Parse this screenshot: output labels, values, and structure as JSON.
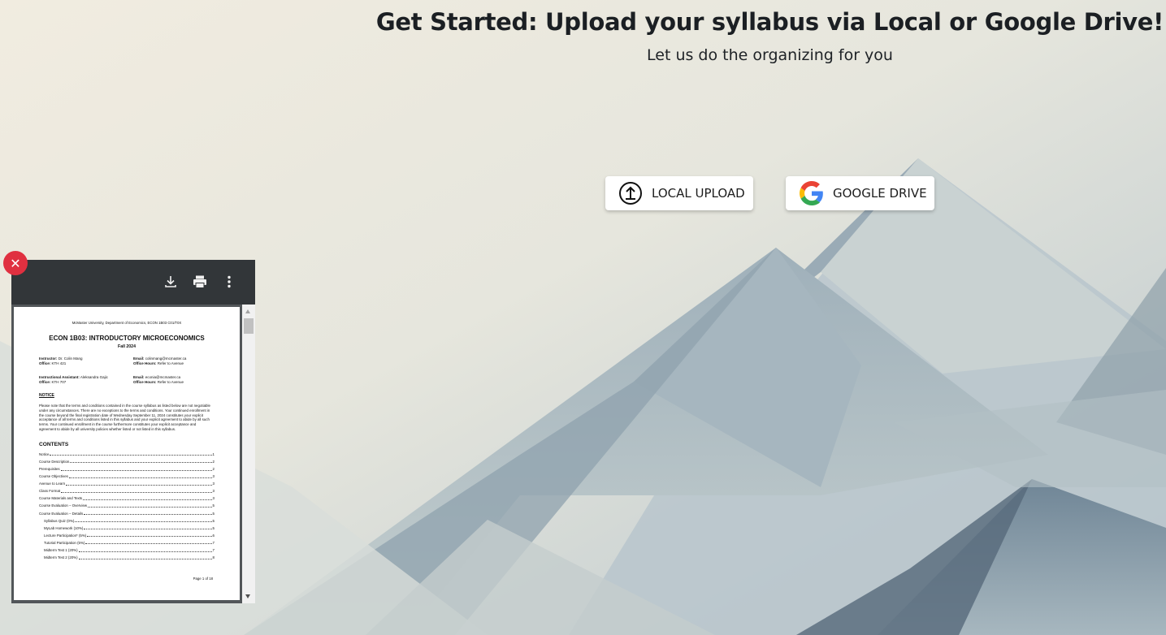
{
  "header": {
    "title": "Get Started: Upload your syllabus via Local or Google Drive!",
    "subtitle": "Let us do the organizing for you"
  },
  "buttons": {
    "local_upload": {
      "label": "LOCAL UPLOAD",
      "icon": "upload-icon"
    },
    "google_drive": {
      "label": "GOOGLE DRIVE",
      "icon": "google-logo-icon"
    }
  },
  "viewer": {
    "close_icon": "close-icon",
    "toolbar_icons": [
      "download-icon",
      "print-icon",
      "more-vert-icon"
    ],
    "page": {
      "header": "McMaster University, Department of Economics, ECON 1B03 C01/T0X",
      "title": "ECON 1B03: INTRODUCTORY MICROECONOMICS",
      "term": "Fall 2024",
      "contacts": [
        {
          "label": "Instructor:",
          "value": "Dr. Colin Mang",
          "label2": "Email:",
          "value2": "colinmang@mcmaster.ca"
        },
        {
          "label": "Office:",
          "value": "KTH 421",
          "label2": "Office Hours:",
          "value2": "Refer to Avenue"
        },
        {
          "label": "Instructional Assistant:",
          "value": "Aleksandra Gajic",
          "label2": "Email:",
          "value2": "econia@mcmaster.ca"
        },
        {
          "label": "Office:",
          "value": "KTH 707",
          "label2": "Office Hours:",
          "value2": "Refer to Avenue"
        }
      ],
      "notice_heading": "NOTICE",
      "notice_text": "Please note that the terms and conditions contained in the course syllabus as listed below are not negotiable under any circumstances. There are no exceptions to the terms and conditions. Your continued enrollment in the course beyond the final registration date of Wednesday September 11, 2024 constitutes your explicit acceptance of all terms and conditions listed in this syllabus and your explicit agreement to abide by all such terms. Your continued enrollment in the course furthermore constitutes your explicit acceptance and agreement to abide by all university policies whether listed or not listed in this syllabus.",
      "contents_heading": "CONTENTS",
      "toc": [
        {
          "title": "Notice",
          "page": "1",
          "sub": false
        },
        {
          "title": "Course Description",
          "page": "2",
          "sub": false
        },
        {
          "title": "Prerequisites",
          "page": "2",
          "sub": false
        },
        {
          "title": "Course Objectives",
          "page": "3",
          "sub": false
        },
        {
          "title": "Avenue to Learn",
          "page": "3",
          "sub": false
        },
        {
          "title": "Class Format",
          "page": "3",
          "sub": false
        },
        {
          "title": "Course Materials and Texts",
          "page": "3",
          "sub": false
        },
        {
          "title": "Course Evaluation – Overview",
          "page": "5",
          "sub": false
        },
        {
          "title": "Course Evaluation – Details",
          "page": "5",
          "sub": false
        },
        {
          "title": "Syllabus Quiz (0%)",
          "page": "5",
          "sub": true
        },
        {
          "title": "MyLab Homework (10%)",
          "page": "5",
          "sub": true
        },
        {
          "title": "Lecture Participation* (5%)",
          "page": "6",
          "sub": true
        },
        {
          "title": "Tutorial Participation (5%)",
          "page": "7",
          "sub": true
        },
        {
          "title": "Midterm Test 1 (20%)",
          "page": "7",
          "sub": true
        },
        {
          "title": "Midterm Test 2 (20%)",
          "page": "8",
          "sub": true
        }
      ],
      "footer": "Page 1 of 18"
    }
  },
  "colors": {
    "close_button": "#e03040",
    "viewer_toolbar": "#323639",
    "title_text": "#1b1f23"
  }
}
